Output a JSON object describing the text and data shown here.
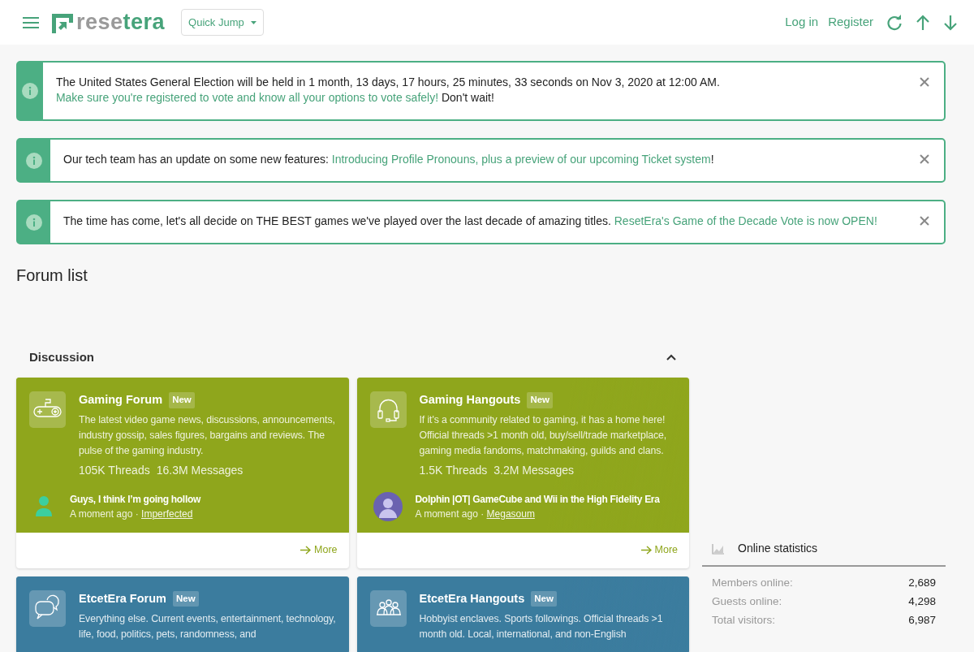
{
  "header": {
    "logo": [
      {
        "text": "rese",
        "kind": "plain"
      },
      {
        "text": "tera",
        "kind": "accent"
      }
    ],
    "quick_jump": "Quick Jump",
    "links": [
      "Log in",
      "Register"
    ]
  },
  "notices": [
    {
      "parts": [
        {
          "text": "The United States General Election will be held in 1 month, 13 days, 17 hours, 25 minutes, 33 seconds on Nov 3, 2020 at 12:00 AM. ",
          "kind": "text"
        },
        {
          "text": "Make sure you're registered to vote and know all your options to vote safely!",
          "kind": "link"
        },
        {
          "text": " Don't wait!",
          "kind": "text"
        }
      ]
    },
    {
      "parts": [
        {
          "text": "Our tech team has an update on some new features: ",
          "kind": "text"
        },
        {
          "text": "Introducing Profile Pronouns, plus a preview of our upcoming Ticket system",
          "kind": "link"
        },
        {
          "text": "!",
          "kind": "text"
        }
      ]
    },
    {
      "parts": [
        {
          "text": "The time has come, let's all decide on THE BEST games we've played over the last decade of amazing titles. ",
          "kind": "text"
        },
        {
          "text": "ResetEra's Game of the Decade Vote is now OPEN!",
          "kind": "link"
        }
      ]
    }
  ],
  "page_title": "Forum list",
  "category": {
    "title": "Discussion",
    "expanded": true,
    "forums": [
      {
        "color": "#8fa61c",
        "title": "Gaming Forum",
        "badge": "New",
        "description": "The latest video game news, discussions, announcements, industry gossip, sales figures, bargains and reviews. The pulse of the gaming industry.",
        "threads": "105K Threads",
        "messages": "16.3M Messages",
        "last_post": {
          "title": "Guys, I think I’m going hollow",
          "time": "A moment ago ·",
          "author": "Imperfected"
        },
        "more": "More"
      },
      {
        "color": "#8fa61c",
        "title": "Gaming Hangouts",
        "badge": "New",
        "description": "If it's a community related to gaming, it has a home here! Official threads >1 month old, buy/sell/trade marketplace, gaming media fandoms, matchmaking, guilds and clans.",
        "threads": "1.5K Threads",
        "messages": "3.2M Messages",
        "last_post": {
          "title": "Dolphin |OT| GameCube and Wii in the High Fidelity Era",
          "time": "A moment ago ·",
          "author": "Megasoum"
        },
        "more": "More"
      },
      {
        "color": "#3b7c9e",
        "title": "EtcetEra Forum",
        "badge": "New",
        "description": "Everything else. Current events, entertainment, technology, life, food, politics, pets, randomness, and"
      },
      {
        "color": "#3b7c9e",
        "title": "EtcetEra Hangouts",
        "badge": "New",
        "description": "Hobbyist enclaves. Sports followings. Official threads >1 month old. Local, international, and non-English"
      }
    ]
  },
  "online_statistics": {
    "title": "Online statistics",
    "rows": [
      {
        "label": "Members online:",
        "value": "2,689"
      },
      {
        "label": "Guests online:",
        "value": "4,298"
      },
      {
        "label": "Total visitors:",
        "value": "6,987"
      }
    ]
  }
}
